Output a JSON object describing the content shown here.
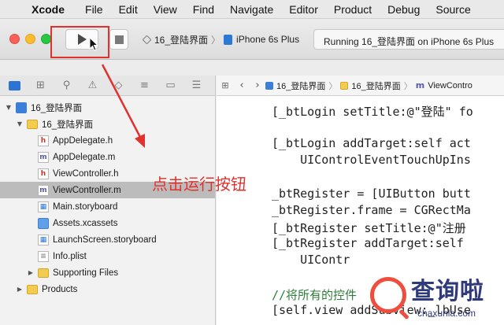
{
  "menubar": {
    "apple_icon": "apple-icon",
    "app_name": "Xcode",
    "items": [
      "File",
      "Edit",
      "View",
      "Find",
      "Navigate",
      "Editor",
      "Product",
      "Debug",
      "Source"
    ]
  },
  "toolbar": {
    "scheme": "16_登陆界面",
    "device": "iPhone 6s Plus",
    "status": "Running 16_登陆界面 on iPhone 6s Plus",
    "colors": {
      "highlight": "#e0312c",
      "close": "#fc5f57",
      "minimize": "#fdbc2e",
      "maximize": "#28c840"
    }
  },
  "navigator": {
    "tab_icons": [
      "folder-icon",
      "hierarchy-icon",
      "search-icon",
      "warning-icon",
      "test-icon",
      "debug-icon",
      "breakpoint-icon",
      "report-icon"
    ],
    "tree": [
      {
        "label": "16_登陆界面",
        "kind": "project",
        "disclosure": "▼",
        "badge": ""
      },
      {
        "label": "16_登陆界面",
        "kind": "folder",
        "disclosure": "▼",
        "badge": ""
      },
      {
        "label": "AppDelegate.h",
        "kind": "h",
        "disclosure": "",
        "badge": "h"
      },
      {
        "label": "AppDelegate.m",
        "kind": "m",
        "disclosure": "",
        "badge": "m"
      },
      {
        "label": "ViewController.h",
        "kind": "h",
        "disclosure": "",
        "badge": "h"
      },
      {
        "label": "ViewController.m",
        "kind": "m",
        "disclosure": "",
        "badge": "m",
        "selected": true
      },
      {
        "label": "Main.storyboard",
        "kind": "storyboard",
        "disclosure": "",
        "badge": ""
      },
      {
        "label": "Assets.xcassets",
        "kind": "assets",
        "disclosure": "",
        "badge": ""
      },
      {
        "label": "LaunchScreen.storyboard",
        "kind": "storyboard",
        "disclosure": "",
        "badge": ""
      },
      {
        "label": "Info.plist",
        "kind": "plist",
        "disclosure": "",
        "badge": ""
      },
      {
        "label": "Supporting Files",
        "kind": "folder",
        "disclosure": "▶",
        "badge": ""
      },
      {
        "label": "Products",
        "kind": "folder",
        "disclosure": "▶",
        "badge": ""
      }
    ]
  },
  "jumpbar": {
    "crumbs": [
      "16_登陆界面",
      "16_登陆界面",
      "ViewContro"
    ]
  },
  "editor": {
    "lines": [
      "[_btLogin setTitle:@\"登陆\" fo",
      "",
      "[_btLogin addTarget:self act",
      "    UIControlEventTouchUpIns",
      "",
      "_btRegister = [UIButton butt",
      "_btRegister.frame = CGRectMa",
      "[_btRegister setTitle:@\"注册",
      "[_btRegister addTarget:self ",
      "    UIContr",
      "",
      "//将所有的控件",
      "[self.view addSubview:_lbUse"
    ]
  },
  "annotation": "点击运行按钮",
  "watermark": {
    "cn": "查询啦",
    "url": "chaxunla.com"
  }
}
